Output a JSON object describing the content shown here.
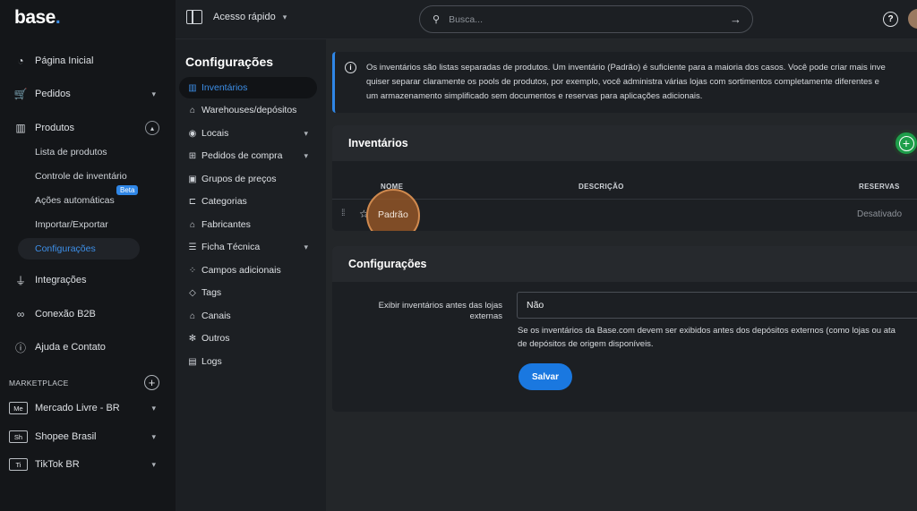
{
  "brand": {
    "logo_text": "base",
    "logo_dot": "."
  },
  "sidebar": {
    "items": [
      {
        "label": "Página Inicial"
      },
      {
        "label": "Pedidos"
      },
      {
        "label": "Produtos"
      },
      {
        "label": "Integrações"
      },
      {
        "label": "Conexão B2B"
      },
      {
        "label": "Ajuda e Contato"
      }
    ],
    "produtos_sub": [
      {
        "label": "Lista de produtos"
      },
      {
        "label": "Controle de inventário"
      },
      {
        "label": "Ações automáticas"
      },
      {
        "label": "Importar/Exportar"
      },
      {
        "label": "Configurações"
      }
    ],
    "beta_label": "Beta",
    "marketplace_label": "MARKETPLACE",
    "marketplaces": [
      {
        "badge": "Me",
        "label": "Mercado Livre - BR"
      },
      {
        "badge": "Sh",
        "label": "Shopee Brasil"
      },
      {
        "badge": "Ti",
        "label": "TikTok BR"
      }
    ]
  },
  "topbar": {
    "quick_access": "Acesso rápido",
    "search_placeholder": "Busca..."
  },
  "config_menu": {
    "title": "Configurações",
    "items": [
      {
        "label": "Inventários",
        "icon": "inventory-icon"
      },
      {
        "label": "Warehouses/depósitos",
        "icon": "warehouse-icon"
      },
      {
        "label": "Locais",
        "icon": "location-pin-icon"
      },
      {
        "label": "Pedidos de compra",
        "icon": "purchase-orders-icon"
      },
      {
        "label": "Grupos de preços",
        "icon": "price-groups-icon"
      },
      {
        "label": "Categorias",
        "icon": "categories-icon"
      },
      {
        "label": "Fabricantes",
        "icon": "manufacturers-icon"
      },
      {
        "label": "Ficha Técnica",
        "icon": "sliders-icon"
      },
      {
        "label": "Campos adicionais",
        "icon": "fields-icon"
      },
      {
        "label": "Tags",
        "icon": "tag-icon"
      },
      {
        "label": "Canais",
        "icon": "channels-icon"
      },
      {
        "label": "Outros",
        "icon": "gear-icon"
      },
      {
        "label": "Logs",
        "icon": "logs-icon"
      }
    ]
  },
  "info": {
    "line1": "Os inventários são listas separadas de produtos. Um inventário (Padrão) é suficiente para a maioria dos casos. Você pode criar mais inve",
    "line2": "quiser separar claramente os pools de produtos, por exemplo, você administra várias lojas com sortimentos completamente diferentes e",
    "line3": "um armazenamento simplificado sem documentos e reservas para aplicações adicionais."
  },
  "inventories": {
    "title": "Inventários",
    "columns": {
      "name": "NOME",
      "description": "DESCRIÇÃO",
      "reservations": "RESERVAS"
    },
    "rows": [
      {
        "name": "Padrão",
        "description": "",
        "reservations": "Desativado"
      }
    ]
  },
  "settings": {
    "title": "Configurações",
    "label_line1": "Exibir inventários antes das lojas",
    "label_line2": "externas",
    "select_value": "Não",
    "hint_line1": "Se os inventários da Base.com devem ser exibidos antes dos depósitos externos (como lojas ou ata",
    "hint_line2": "de depósitos de origem disponíveis.",
    "save_label": "Salvar"
  },
  "colors": {
    "accent": "#2f86e6",
    "add_button": "#1e9e4a",
    "highlight": "#a05c28"
  }
}
